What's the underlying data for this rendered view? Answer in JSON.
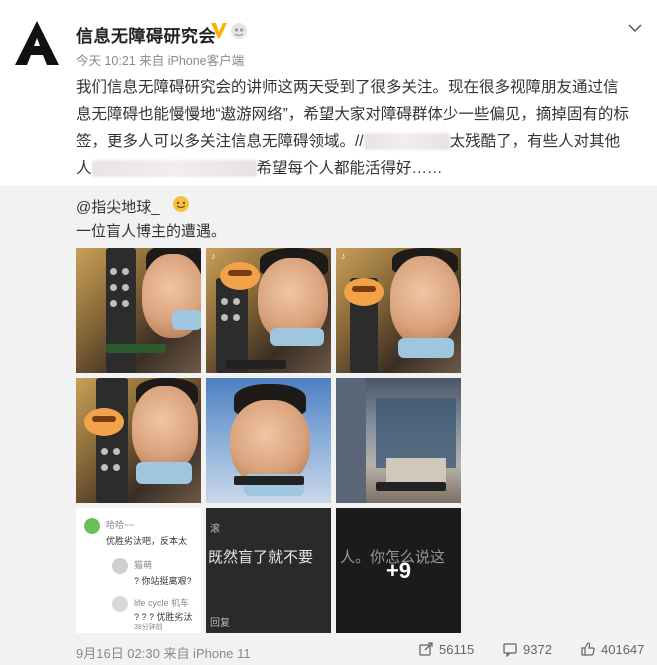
{
  "post": {
    "username": "信息无障碍研究会",
    "meta": "今天 10:21 来自 iPhone客户端",
    "content_line1": "我们信息无障碍研究会的讲师这两天受到了很多关注。现在很多视障朋友通过信",
    "content_line2": "息无障碍也能慢慢地“遨游网络”，希望大家对障碍群体少一些偏见，摘掉固有的标",
    "content_line3_a": "签，更多人可以多关注信息无障碍领域。//",
    "content_line3_b": "太残酷了，有些人对其他",
    "content_line4_a": "人",
    "content_line4_b": "希望每个人都能活得好……"
  },
  "repost": {
    "username": "@指尖地球_",
    "text": "一位盲人博主的遭遇。",
    "more_count": "+9",
    "comments": {
      "c1_name": "哈哈~~",
      "c1_text": "优胜劣汰吧，反本太",
      "c2_name": "猫萌",
      "c2_text": "? 你站挺离艰?",
      "c3_name": "life cycle 机车",
      "c3_text": "? ? ? 优胜劣汰",
      "c3_time": "38分钟前"
    },
    "dark_text_1": "既然盲了就不要",
    "dark_text_2": "人。你怎么说这",
    "dark_small_1": "滚",
    "dark_small_2": "回复"
  },
  "footer": {
    "time": "9月16日 02:30 来自 iPhone 11",
    "reposts": "56115",
    "comments": "9372",
    "likes": "401647"
  },
  "colors": {
    "verify": "#f6b400",
    "link": "#333333"
  }
}
